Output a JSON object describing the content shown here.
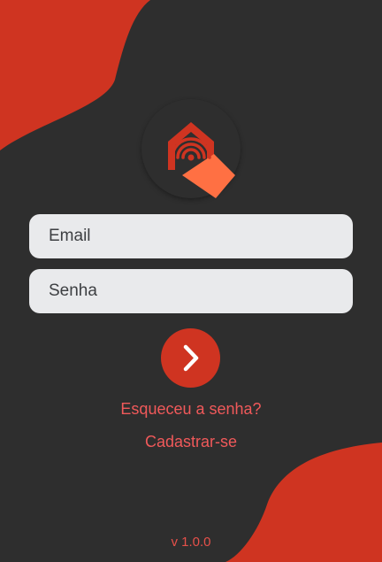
{
  "login": {
    "email_placeholder": "Email",
    "password_placeholder": "Senha",
    "submit_icon": "chevron-right-icon",
    "forgot_password_label": "Esqueceu a senha?",
    "signup_label": "Cadastrar-se"
  },
  "logo": {
    "icon": "house-signal-icon"
  },
  "footer": {
    "version": "v 1.0.0"
  },
  "colors": {
    "accent": "#cf3421",
    "panel": "#2e2e2e",
    "link": "#f0595a",
    "field_bg": "#e9eaec",
    "logo_orange": "#ff7043"
  }
}
